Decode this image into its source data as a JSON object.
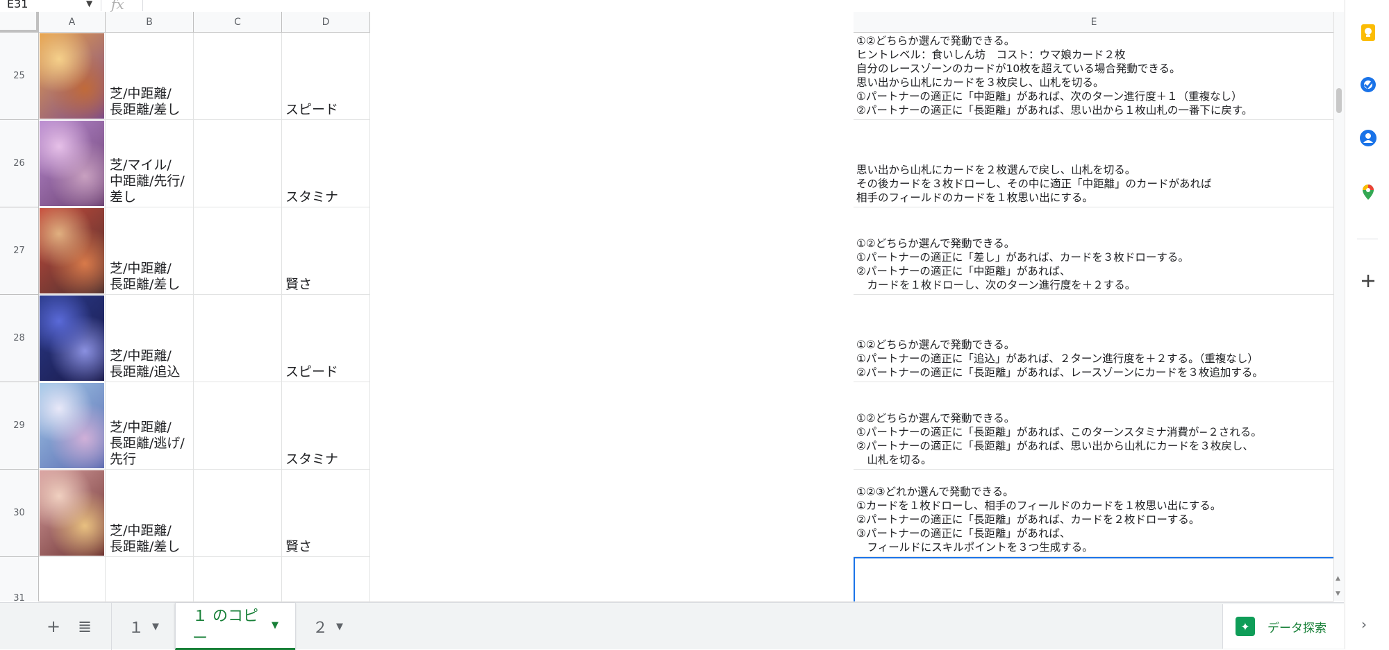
{
  "formula_bar": {
    "cell_ref": "E31",
    "fx": "fx"
  },
  "columns": [
    "A",
    "B",
    "C",
    "D",
    "E"
  ],
  "rows": [
    {
      "num": "25",
      "b": [
        "芝/中距離/",
        "長距離/差し"
      ],
      "d": "スピード",
      "e": [
        "①②どちらか選んで発動できる。",
        "ヒントレベル：食いしん坊　コスト：ウマ娘カード２枚",
        "自分のレースゾーンのカードが10枚を超えている場合発動できる。",
        "思い出から山札にカードを３枚戻し、山札を切る。",
        "①パートナーの適正に「中距離」があれば、次のターン進行度＋１（重複なし）",
        "②パートナーの適正に「長距離」があれば、思い出から１枚山札の一番下に戻す。"
      ]
    },
    {
      "num": "26",
      "b": [
        "芝/マイル/",
        "中距離/先行/",
        "差し"
      ],
      "d": "スタミナ",
      "e": [
        "思い出から山札にカードを２枚選んで戻し、山札を切る。",
        "その後カードを３枚ドローし、その中に適正「中距離」のカードがあれば",
        "相手のフィールドのカードを１枚思い出にする。"
      ]
    },
    {
      "num": "27",
      "b": [
        "芝/中距離/",
        "長距離/差し"
      ],
      "d": "賢さ",
      "e": [
        "①②どちらか選んで発動できる。",
        "①パートナーの適正に「差し」があれば、カードを３枚ドローする。",
        "②パートナーの適正に「中距離」があれば、",
        "　カードを１枚ドローし、次のターン進行度を＋２する。"
      ]
    },
    {
      "num": "28",
      "b": [
        "芝/中距離/",
        "長距離/追込"
      ],
      "d": "スピード",
      "e": [
        "①②どちらか選んで発動できる。",
        "①パートナーの適正に「追込」があれば、２ターン進行度を＋２する。（重複なし）",
        "②パートナーの適正に「長距離」があれば、レースゾーンにカードを３枚追加する。"
      ]
    },
    {
      "num": "29",
      "b": [
        "芝/中距離/",
        "長距離/逃げ/",
        "先行"
      ],
      "d": "スタミナ",
      "e": [
        "①②どちらか選んで発動できる。",
        "①パートナーの適正に「長距離」があれば、このターンスタミナ消費が−２される。",
        "②パートナーの適正に「長距離」があれば、思い出から山札にカードを３枚戻し、",
        "　山札を切る。"
      ]
    },
    {
      "num": "30",
      "b": [
        "芝/中距離/",
        "長距離/差し"
      ],
      "d": "賢さ",
      "e": [
        "①②③どれか選んで発動できる。",
        "①カードを１枚ドローし、相手のフィールドのカードを１枚思い出にする。",
        "②パートナーの適正に「長距離」があれば、カードを２枚ドローする。",
        "③パートナーの適正に「長距離」があれば、",
        "　フィールドにスキルポイントを３つ生成する。"
      ]
    },
    {
      "num": "31",
      "b": [],
      "d": "",
      "e": []
    }
  ],
  "thumb_colors": [
    [
      "#e8a24a",
      "#f5d08a",
      "#7a4a8c",
      "#c06a3a"
    ],
    [
      "#b88ad0",
      "#e6c0e8",
      "#6a4070",
      "#c8a0c0"
    ],
    [
      "#c84a3a",
      "#e0b080",
      "#4a3030",
      "#d87a4a"
    ],
    [
      "#2a3a8a",
      "#5a6ad8",
      "#1a1a4a",
      "#8a90e0"
    ],
    [
      "#a0c8e8",
      "#e8e8f8",
      "#5a6ab0",
      "#d0b0d8"
    ],
    [
      "#d8a0a0",
      "#f0d0c0",
      "#6a3030",
      "#e8c080"
    ]
  ],
  "tabs": [
    {
      "label": "１",
      "active": false
    },
    {
      "label": "１ のコピー",
      "active": true
    },
    {
      "label": "２",
      "active": false
    }
  ],
  "explore_label": "データ探索",
  "side_icons": [
    "keep-icon",
    "tasks-icon",
    "contacts-icon",
    "maps-icon",
    "add-icon"
  ]
}
